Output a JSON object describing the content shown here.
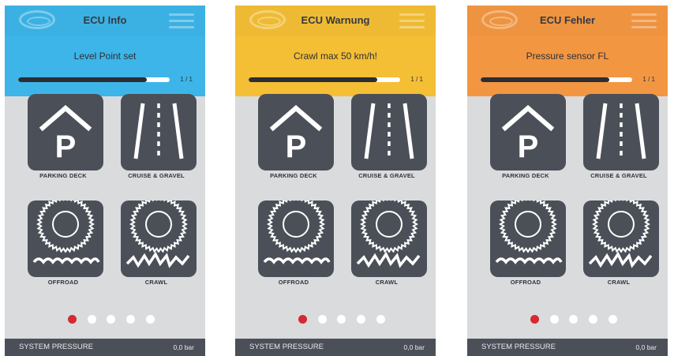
{
  "screens": [
    {
      "title": "ECU Info",
      "message": "Level Point set",
      "header_color": "#3db5e8",
      "progress": 0.85,
      "page_counter": "1 / 1",
      "tiles": [
        "PARKING DECK",
        "CRUISE & GRAVEL",
        "OFFROAD",
        "CRAWL"
      ],
      "pagination": {
        "count": 5,
        "active": 0
      },
      "footer": {
        "label": "SYSTEM PRESSURE",
        "value": "0,0 bar"
      }
    },
    {
      "title": "ECU Warnung",
      "message": "Crawl max 50 km/h!",
      "header_color": "#f4be35",
      "progress": 0.85,
      "page_counter": "1 / 1",
      "tiles": [
        "PARKING DECK",
        "CRUISE & GRAVEL",
        "OFFROAD",
        "CRAWL"
      ],
      "pagination": {
        "count": 5,
        "active": 0
      },
      "footer": {
        "label": "SYSTEM PRESSURE",
        "value": "0,0 bar"
      }
    },
    {
      "title": "ECU Fehler",
      "message": "Pressure sensor FL",
      "header_color": "#f39642",
      "progress": 0.85,
      "page_counter": "1 / 1",
      "tiles": [
        "PARKING DECK",
        "CRUISE & GRAVEL",
        "OFFROAD",
        "CRAWL"
      ],
      "pagination": {
        "count": 5,
        "active": 0
      },
      "footer": {
        "label": "SYSTEM PRESSURE",
        "value": "0,0 bar"
      }
    }
  ],
  "icons": [
    "logo-icon",
    "menu-icon",
    "parking-deck-icon",
    "road-icon",
    "offroad-tire-icon",
    "crawl-tire-icon"
  ],
  "colors": {
    "tile": "#4b5058",
    "dot_active": "#d42a30",
    "dot_inactive": "#ffffff",
    "footer": "#4b5058"
  }
}
